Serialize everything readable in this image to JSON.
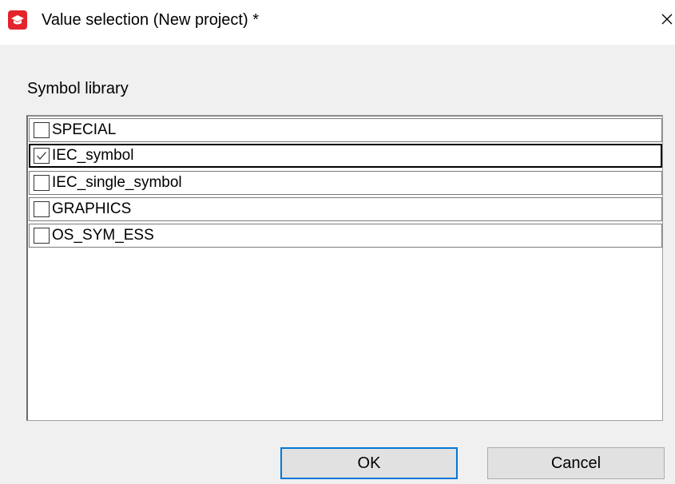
{
  "window": {
    "title": "Value selection (New project) *",
    "close_glyph": "✕",
    "icon": "app-logo-icon"
  },
  "group": {
    "label": "Symbol library"
  },
  "list": {
    "items": [
      {
        "label": "SPECIAL",
        "checked": false
      },
      {
        "label": "IEC_symbol",
        "checked": true
      },
      {
        "label": "IEC_single_symbol",
        "checked": false
      },
      {
        "label": "GRAPHICS",
        "checked": false
      },
      {
        "label": "OS_SYM_ESS",
        "checked": false
      }
    ]
  },
  "buttons": {
    "ok_label": "OK",
    "cancel_label": "Cancel"
  },
  "colors": {
    "app_icon": "#e3242b",
    "default_button_border": "#0078d7"
  }
}
